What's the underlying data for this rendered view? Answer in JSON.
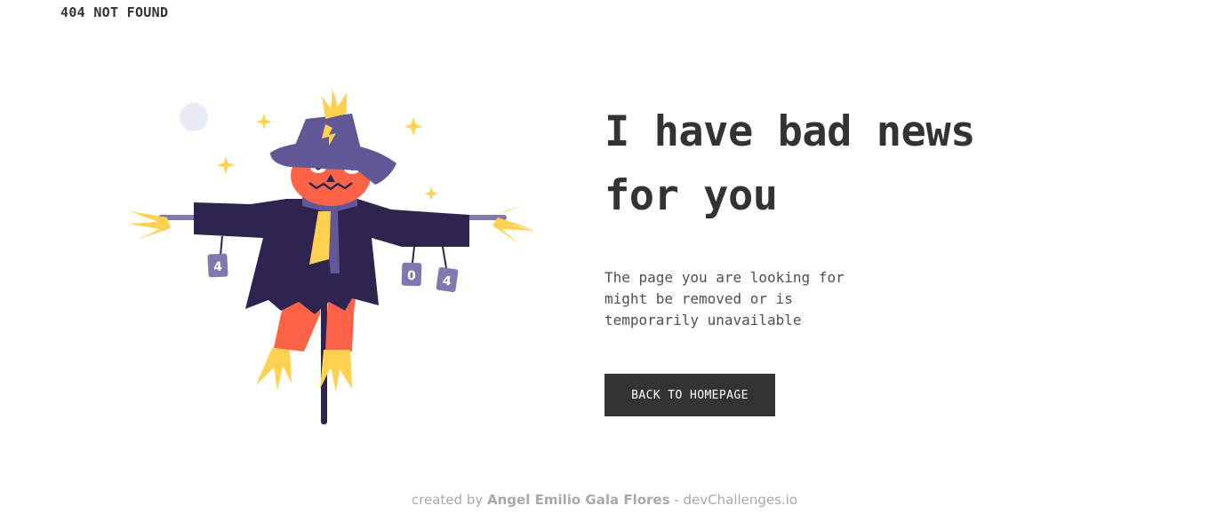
{
  "brand": "404 NOT FOUND",
  "headline": "I have bad news for you",
  "message": "The page you are looking for might be removed or is temporarily unavailable",
  "cta": "BACK TO HOMEPAGE",
  "footer": {
    "prefix": "created by",
    "author": "Angel Emilio Gala Flores",
    "separator": "-",
    "site": "devChallenges.io"
  },
  "illustration": {
    "cans": [
      "4",
      "0",
      "4"
    ],
    "colors": {
      "coat": "#2d2550",
      "hat": "#625898",
      "face": "#ff6347",
      "straw": "#ffd150",
      "cans": "#8278b0",
      "moon": "#e8eaf6"
    }
  }
}
